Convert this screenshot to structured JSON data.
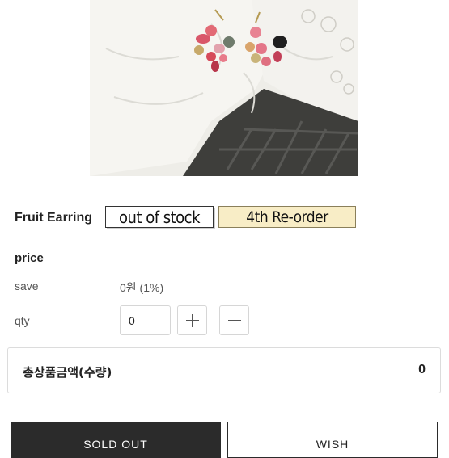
{
  "product": {
    "name": "Fruit Earring",
    "tags": {
      "stock": "out of stock",
      "reorder": "4th Re-order"
    },
    "tag_colors": {
      "reorder_bg": "#f8edc6"
    }
  },
  "price": {
    "label": "price",
    "save_label": "save",
    "save_value": "0원 (1%)"
  },
  "qty": {
    "label": "qty",
    "value": "0",
    "plus_icon": "plus-icon",
    "minus_icon": "minus-icon"
  },
  "total": {
    "label": "총상품금액(수량)",
    "value": "0"
  },
  "actions": {
    "soldout_label": "SOLD OUT",
    "wish_label": "WISH",
    "soldout_bg": "#2b2b2b"
  }
}
